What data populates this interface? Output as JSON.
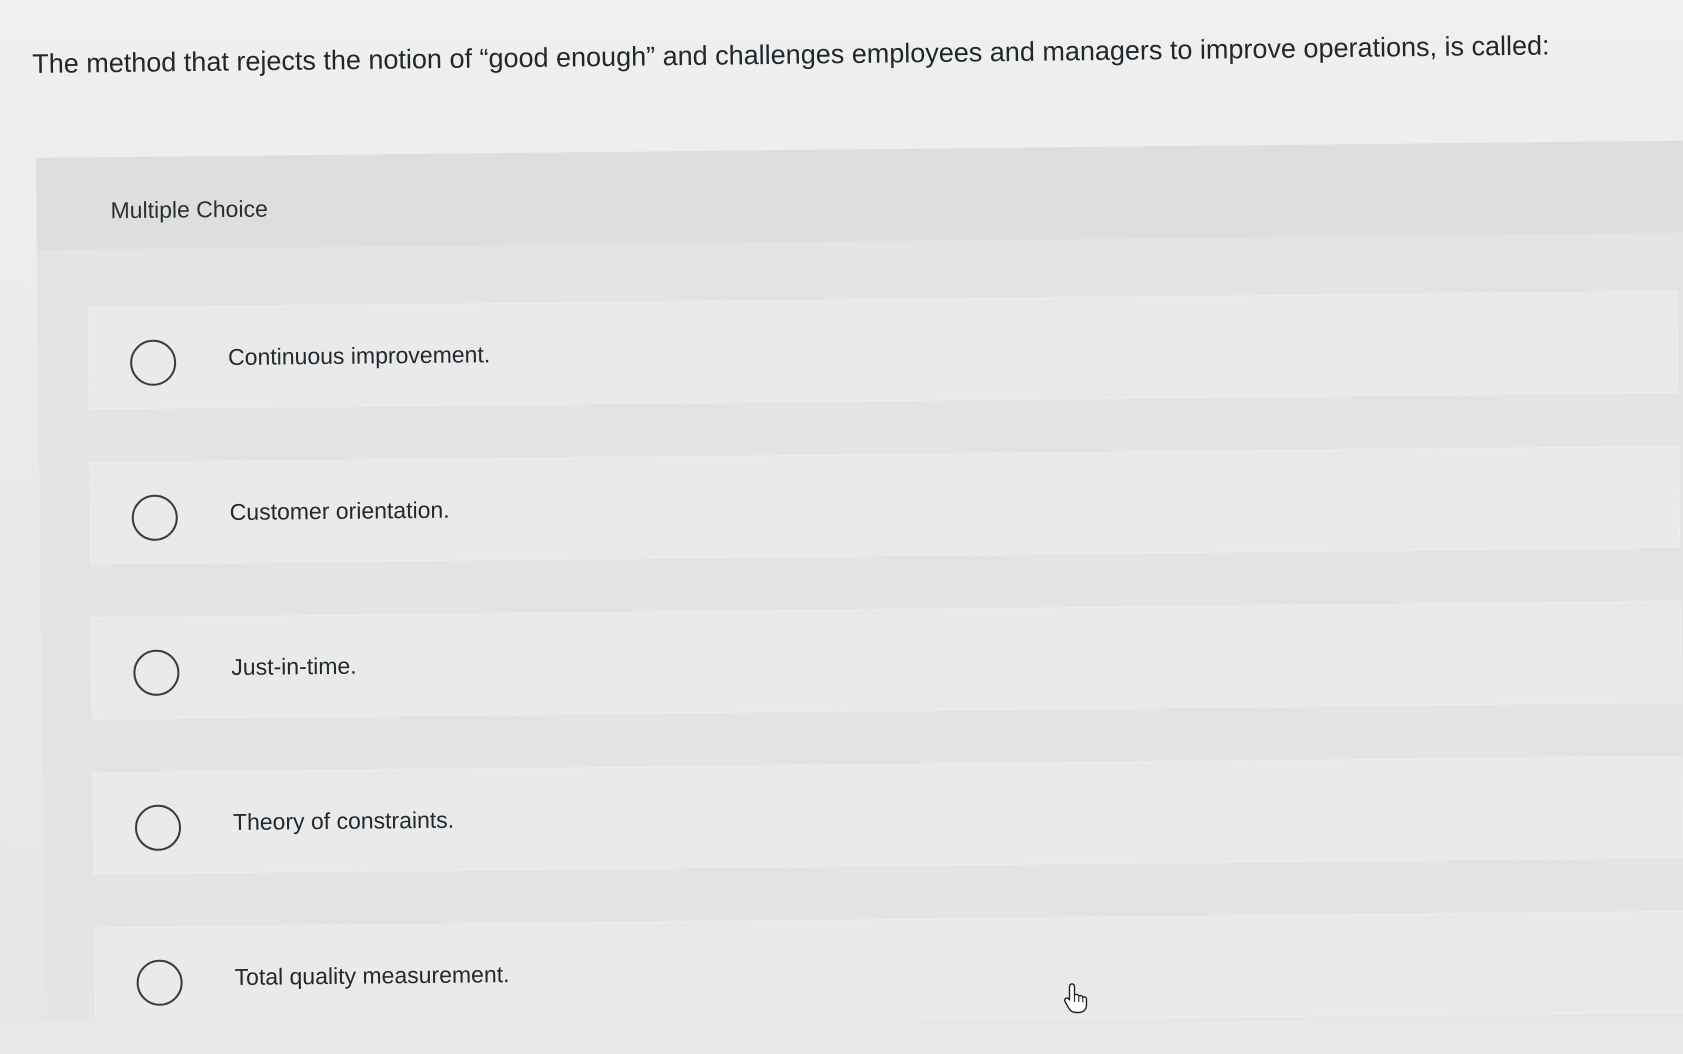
{
  "question": {
    "text": "The method that rejects the notion of “good enough” and challenges employees and managers to improve operations, is called:"
  },
  "mc": {
    "label": "Multiple Choice",
    "options": [
      {
        "label": "Continuous improvement."
      },
      {
        "label": "Customer orientation."
      },
      {
        "label": "Just-in-time."
      },
      {
        "label": "Theory of constraints."
      },
      {
        "label": "Total quality measurement."
      }
    ]
  },
  "cursor": {
    "icon": "hand-pointer-icon"
  }
}
